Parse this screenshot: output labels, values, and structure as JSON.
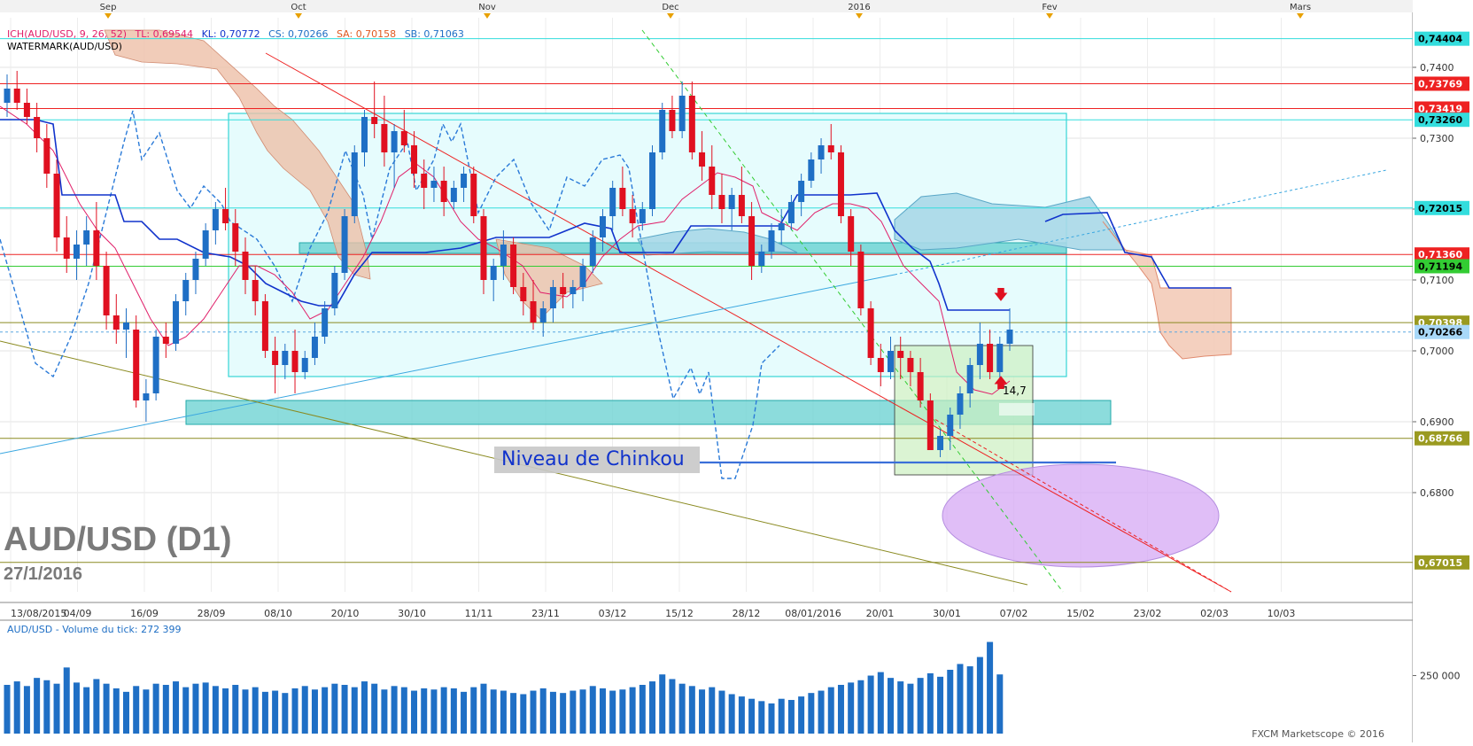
{
  "top_axis": {
    "months": [
      "Sep",
      "Oct",
      "Nov",
      "Dec",
      "2016",
      "Fev",
      "Mars"
    ]
  },
  "legend": {
    "ich": "ICH(AUD/USD, 9, 26, 52)",
    "tl": "TL: 0,69544",
    "kl": "KL: 0,70772",
    "cs": "CS: 0,70266",
    "sa": "SA: 0,70158",
    "sb": "SB: 0,71063",
    "watermark_label": "WATERMARK(AUD/USD)"
  },
  "watermark": {
    "title": "AUD/USD (D1)",
    "date": "27/1/2016"
  },
  "annotation": {
    "chinkou": "Niveau de Chinkou",
    "marker": "14,7"
  },
  "volume": {
    "legend": "AUD/USD - Volume du tick: 272 399",
    "tick_label": "250 000"
  },
  "credit": "FXCM Marketscope © 2016",
  "colors": {
    "bull": "#1f6fc5",
    "bear": "#e01020",
    "tenkan": "#e0206a",
    "kijun": "#1133cc",
    "cyan_level": "#33dddd",
    "red_level": "#ee2222",
    "green_level": "#33cc33",
    "olive_level": "#8a8a20"
  },
  "chart_data": {
    "type": "candlestick",
    "instrument": "AUD/USD",
    "timeframe": "D1",
    "ylim": [
      0.666,
      0.747
    ],
    "y_ticks": [
      "0,7400",
      "0,7300",
      "0,7200",
      "0,7100",
      "0,7000",
      "0,6900",
      "0,6800"
    ],
    "x_ticks": [
      "13/08/2015",
      "04/09",
      "16/09",
      "28/09",
      "08/10",
      "20/10",
      "30/10",
      "11/11",
      "23/11",
      "03/12",
      "15/12",
      "28/12",
      "08/01/2016",
      "20/01",
      "30/01",
      "07/02",
      "15/02",
      "23/02",
      "02/03",
      "10/03"
    ],
    "levels": [
      {
        "label": "0,74404",
        "value": 0.74404,
        "kind": "cyan"
      },
      {
        "label": "0,73769",
        "value": 0.73769,
        "kind": "red"
      },
      {
        "label": "0,73419",
        "value": 0.73419,
        "kind": "red"
      },
      {
        "label": "0,73260",
        "value": 0.7326,
        "kind": "cyan"
      },
      {
        "label": "0,72015",
        "value": 0.72015,
        "kind": "cyan"
      },
      {
        "label": "0,71360",
        "value": 0.7136,
        "kind": "red"
      },
      {
        "label": "0,71194",
        "value": 0.71194,
        "kind": "green"
      },
      {
        "label": "0,70398",
        "value": 0.70398,
        "kind": "olive"
      },
      {
        "label": "0,70266",
        "value": 0.70266,
        "kind": "current"
      },
      {
        "label": "0,68766",
        "value": 0.68766,
        "kind": "olive"
      },
      {
        "label": "0,67015",
        "value": 0.67015,
        "kind": "olive"
      }
    ],
    "candles": [
      [
        0.735,
        0.739,
        0.733,
        0.737
      ],
      [
        0.737,
        0.7395,
        0.734,
        0.735
      ],
      [
        0.735,
        0.737,
        0.732,
        0.733
      ],
      [
        0.733,
        0.735,
        0.728,
        0.73
      ],
      [
        0.73,
        0.732,
        0.723,
        0.725
      ],
      [
        0.725,
        0.727,
        0.714,
        0.716
      ],
      [
        0.716,
        0.719,
        0.711,
        0.713
      ],
      [
        0.713,
        0.717,
        0.71,
        0.715
      ],
      [
        0.715,
        0.719,
        0.712,
        0.717
      ],
      [
        0.717,
        0.721,
        0.71,
        0.712
      ],
      [
        0.712,
        0.714,
        0.703,
        0.705
      ],
      [
        0.705,
        0.708,
        0.701,
        0.703
      ],
      [
        0.703,
        0.706,
        0.699,
        0.704
      ],
      [
        0.703,
        0.705,
        0.692,
        0.693
      ],
      [
        0.693,
        0.696,
        0.69,
        0.694
      ],
      [
        0.694,
        0.703,
        0.693,
        0.702
      ],
      [
        0.702,
        0.704,
        0.699,
        0.701
      ],
      [
        0.701,
        0.708,
        0.7,
        0.707
      ],
      [
        0.707,
        0.711,
        0.705,
        0.71
      ],
      [
        0.71,
        0.714,
        0.708,
        0.713
      ],
      [
        0.713,
        0.718,
        0.712,
        0.717
      ],
      [
        0.717,
        0.721,
        0.715,
        0.72
      ],
      [
        0.72,
        0.723,
        0.717,
        0.718
      ],
      [
        0.718,
        0.72,
        0.712,
        0.714
      ],
      [
        0.714,
        0.716,
        0.708,
        0.71
      ],
      [
        0.71,
        0.712,
        0.705,
        0.707
      ],
      [
        0.707,
        0.708,
        0.699,
        0.7
      ],
      [
        0.7,
        0.702,
        0.694,
        0.698
      ],
      [
        0.698,
        0.701,
        0.696,
        0.7
      ],
      [
        0.7,
        0.703,
        0.694,
        0.697
      ],
      [
        0.697,
        0.7,
        0.696,
        0.699
      ],
      [
        0.699,
        0.704,
        0.698,
        0.702
      ],
      [
        0.702,
        0.707,
        0.701,
        0.706
      ],
      [
        0.706,
        0.712,
        0.705,
        0.711
      ],
      [
        0.711,
        0.72,
        0.71,
        0.719
      ],
      [
        0.719,
        0.729,
        0.718,
        0.728
      ],
      [
        0.728,
        0.734,
        0.726,
        0.733
      ],
      [
        0.733,
        0.738,
        0.73,
        0.732
      ],
      [
        0.732,
        0.736,
        0.726,
        0.728
      ],
      [
        0.728,
        0.732,
        0.723,
        0.731
      ],
      [
        0.731,
        0.734,
        0.728,
        0.729
      ],
      [
        0.729,
        0.731,
        0.723,
        0.725
      ],
      [
        0.725,
        0.727,
        0.72,
        0.723
      ],
      [
        0.723,
        0.726,
        0.721,
        0.724
      ],
      [
        0.724,
        0.726,
        0.719,
        0.721
      ],
      [
        0.721,
        0.724,
        0.72,
        0.723
      ],
      [
        0.723,
        0.726,
        0.721,
        0.725
      ],
      [
        0.725,
        0.726,
        0.718,
        0.719
      ],
      [
        0.719,
        0.72,
        0.708,
        0.71
      ],
      [
        0.71,
        0.713,
        0.707,
        0.712
      ],
      [
        0.712,
        0.717,
        0.71,
        0.715
      ],
      [
        0.715,
        0.716,
        0.708,
        0.709
      ],
      [
        0.709,
        0.711,
        0.705,
        0.707
      ],
      [
        0.707,
        0.71,
        0.703,
        0.704
      ],
      [
        0.704,
        0.707,
        0.702,
        0.706
      ],
      [
        0.706,
        0.71,
        0.704,
        0.709
      ],
      [
        0.709,
        0.711,
        0.706,
        0.708
      ],
      [
        0.708,
        0.71,
        0.706,
        0.709
      ],
      [
        0.709,
        0.713,
        0.707,
        0.712
      ],
      [
        0.712,
        0.717,
        0.711,
        0.716
      ],
      [
        0.716,
        0.72,
        0.714,
        0.719
      ],
      [
        0.719,
        0.724,
        0.717,
        0.723
      ],
      [
        0.723,
        0.726,
        0.719,
        0.72
      ],
      [
        0.72,
        0.722,
        0.716,
        0.718
      ],
      [
        0.718,
        0.721,
        0.717,
        0.72
      ],
      [
        0.72,
        0.729,
        0.719,
        0.728
      ],
      [
        0.728,
        0.735,
        0.727,
        0.734
      ],
      [
        0.734,
        0.736,
        0.73,
        0.731
      ],
      [
        0.731,
        0.738,
        0.73,
        0.736
      ],
      [
        0.736,
        0.738,
        0.727,
        0.728
      ],
      [
        0.728,
        0.731,
        0.724,
        0.726
      ],
      [
        0.726,
        0.729,
        0.72,
        0.722
      ],
      [
        0.722,
        0.725,
        0.718,
        0.72
      ],
      [
        0.72,
        0.723,
        0.717,
        0.722
      ],
      [
        0.722,
        0.726,
        0.718,
        0.719
      ],
      [
        0.719,
        0.721,
        0.71,
        0.712
      ],
      [
        0.712,
        0.715,
        0.711,
        0.714
      ],
      [
        0.714,
        0.718,
        0.713,
        0.717
      ],
      [
        0.717,
        0.72,
        0.715,
        0.718
      ],
      [
        0.718,
        0.722,
        0.717,
        0.721
      ],
      [
        0.721,
        0.725,
        0.719,
        0.724
      ],
      [
        0.724,
        0.728,
        0.723,
        0.727
      ],
      [
        0.727,
        0.73,
        0.725,
        0.729
      ],
      [
        0.729,
        0.732,
        0.727,
        0.728
      ],
      [
        0.728,
        0.729,
        0.718,
        0.719
      ],
      [
        0.719,
        0.72,
        0.712,
        0.714
      ],
      [
        0.714,
        0.715,
        0.705,
        0.706
      ],
      [
        0.706,
        0.707,
        0.698,
        0.699
      ],
      [
        0.699,
        0.701,
        0.695,
        0.697
      ],
      [
        0.697,
        0.702,
        0.696,
        0.7
      ],
      [
        0.7,
        0.702,
        0.696,
        0.699
      ],
      [
        0.699,
        0.7,
        0.695,
        0.697
      ],
      [
        0.697,
        0.699,
        0.692,
        0.693
      ],
      [
        0.693,
        0.694,
        0.686,
        0.686
      ],
      [
        0.686,
        0.689,
        0.685,
        0.688
      ],
      [
        0.688,
        0.692,
        0.686,
        0.691
      ],
      [
        0.691,
        0.695,
        0.689,
        0.694
      ],
      [
        0.694,
        0.699,
        0.692,
        0.698
      ],
      [
        0.698,
        0.704,
        0.696,
        0.701
      ],
      [
        0.701,
        0.703,
        0.696,
        0.697
      ],
      [
        0.697,
        0.702,
        0.695,
        0.701
      ],
      [
        0.701,
        0.706,
        0.7,
        0.703
      ]
    ],
    "volume": [
      210,
      225,
      205,
      240,
      230,
      215,
      285,
      220,
      200,
      235,
      215,
      195,
      180,
      205,
      190,
      215,
      210,
      225,
      200,
      215,
      220,
      205,
      195,
      210,
      190,
      200,
      180,
      185,
      175,
      195,
      205,
      190,
      200,
      215,
      210,
      200,
      225,
      215,
      190,
      205,
      200,
      185,
      195,
      190,
      200,
      195,
      180,
      200,
      215,
      190,
      185,
      175,
      170,
      185,
      195,
      180,
      175,
      185,
      190,
      205,
      195,
      185,
      190,
      200,
      210,
      225,
      255,
      235,
      215,
      205,
      190,
      200,
      185,
      170,
      160,
      150,
      140,
      130,
      150,
      145,
      160,
      175,
      185,
      200,
      210,
      220,
      230,
      250,
      265,
      240,
      225,
      215,
      240,
      260,
      245,
      275,
      300,
      290,
      330,
      395,
      255
    ]
  }
}
